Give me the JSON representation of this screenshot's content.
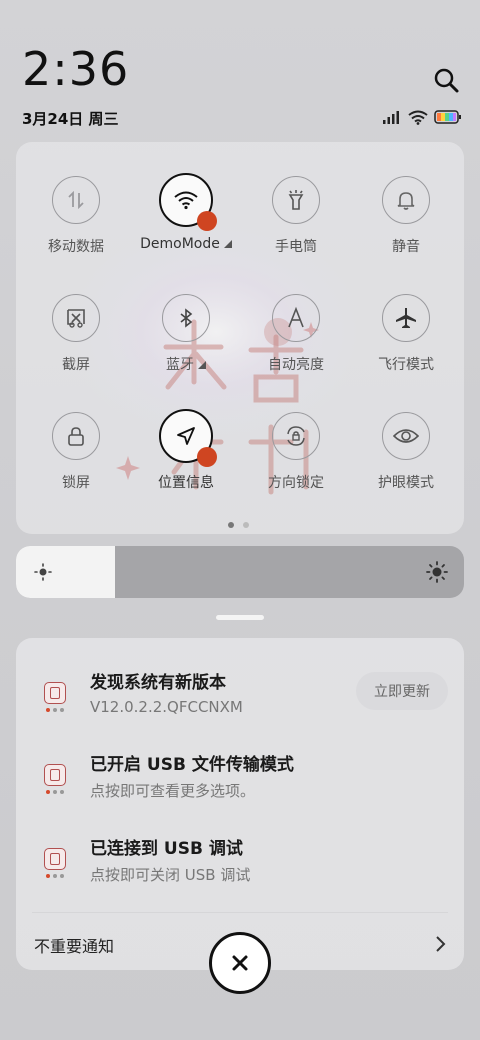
{
  "status": {
    "time": "2:36",
    "date": "3月24日 周三"
  },
  "quick_settings": {
    "tiles": [
      {
        "label": "移动数据",
        "icon": "mobile-data-icon",
        "active": false
      },
      {
        "label": "DemoMode",
        "icon": "wifi-icon",
        "active": true
      },
      {
        "label": "手电筒",
        "icon": "flashlight-icon",
        "active": false
      },
      {
        "label": "静音",
        "icon": "bell-icon",
        "active": false
      },
      {
        "label": "截屏",
        "icon": "screenshot-icon",
        "active": false
      },
      {
        "label": "蓝牙",
        "icon": "bluetooth-icon",
        "active": false
      },
      {
        "label": "自动亮度",
        "icon": "auto-brightness-icon",
        "active": false
      },
      {
        "label": "飞行模式",
        "icon": "airplane-icon",
        "active": false
      },
      {
        "label": "锁屏",
        "icon": "lock-icon",
        "active": false
      },
      {
        "label": "位置信息",
        "icon": "location-icon",
        "active": true
      },
      {
        "label": "方向锁定",
        "icon": "rotation-lock-icon",
        "active": false
      },
      {
        "label": "护眼模式",
        "icon": "eye-icon",
        "active": false
      }
    ],
    "page_count": 2,
    "current_page": 1
  },
  "brightness": {
    "level": 0.22
  },
  "notifications": [
    {
      "title": "发现系统有新版本",
      "body": "V12.0.2.2.QFCCNXM",
      "action": "立即更新"
    },
    {
      "title": "已开启 USB 文件传输模式",
      "body": "点按即可查看更多选项。"
    },
    {
      "title": "已连接到 USB 调试",
      "body": "点按即可关闭 USB 调试"
    }
  ],
  "unimportant_label": "不重要通知",
  "colors": {
    "accent_dot": "#cf4521",
    "active_tile_border": "#111111"
  }
}
